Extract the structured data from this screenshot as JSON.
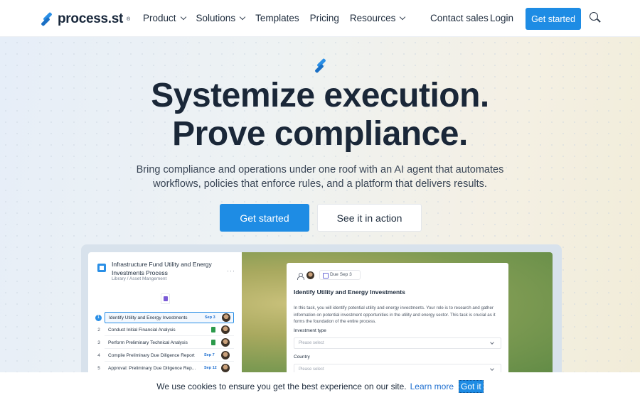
{
  "nav": {
    "logo_text": "process.st",
    "logo_tm": "®",
    "menu": [
      {
        "label": "Product",
        "dropdown": true
      },
      {
        "label": "Solutions",
        "dropdown": true
      },
      {
        "label": "Templates",
        "dropdown": false
      },
      {
        "label": "Pricing",
        "dropdown": false
      },
      {
        "label": "Resources",
        "dropdown": true
      }
    ],
    "contact": "Contact sales",
    "login": "Login",
    "cta": "Get started"
  },
  "hero": {
    "title_line1": "Systemize execution.",
    "title_line2": "Prove compliance.",
    "subtitle_line1": "Bring compliance and operations under one roof with an AI agent that automates",
    "subtitle_line2": "workflows, policies that enforce rules, and a platform that delivers results.",
    "cta_primary": "Get started",
    "cta_secondary": "See it in action"
  },
  "preview": {
    "project_title": "Infrastructure Fund Utility and Energy Investments Process",
    "project_path": "Library / Asset Mangement",
    "tasks": [
      {
        "num": "1",
        "label": "Identify Utility and Energy Investments",
        "due": "Sep 3",
        "active": true,
        "sheet": false
      },
      {
        "num": "2",
        "label": "Conduct Initial Financial Analysis",
        "due": "",
        "active": false,
        "sheet": true
      },
      {
        "num": "3",
        "label": "Perform Preliminary Technical Analysis",
        "due": "",
        "active": false,
        "sheet": true
      },
      {
        "num": "4",
        "label": "Compile Preliminary Due Diligence Report",
        "due": "Sep 7",
        "active": false,
        "sheet": false
      },
      {
        "num": "5",
        "label": "Approval: Preliminary Due Diligence Rep...",
        "due": "Sep 12",
        "active": false,
        "sheet": false
      }
    ],
    "card": {
      "due": "Due Sep 3",
      "title": "Identify Utility and Energy Investments",
      "description": "In this task, you will identify potential utility and energy investments. Your role is to research and gather information on potential investment opportunities in the utility and energy sector. This task is crucial as it forms the foundation of the entire process.",
      "field1_label": "Investment type",
      "field1_placeholder": "Please select",
      "field2_label": "Country",
      "field2_placeholder": "Please select"
    }
  },
  "cookie": {
    "text": "We use cookies to ensure you get the best experience on our site.",
    "learn_more": "Learn more",
    "button": "Got it"
  },
  "colors": {
    "accent": "#1e8ce4",
    "heading": "#1a2738"
  }
}
